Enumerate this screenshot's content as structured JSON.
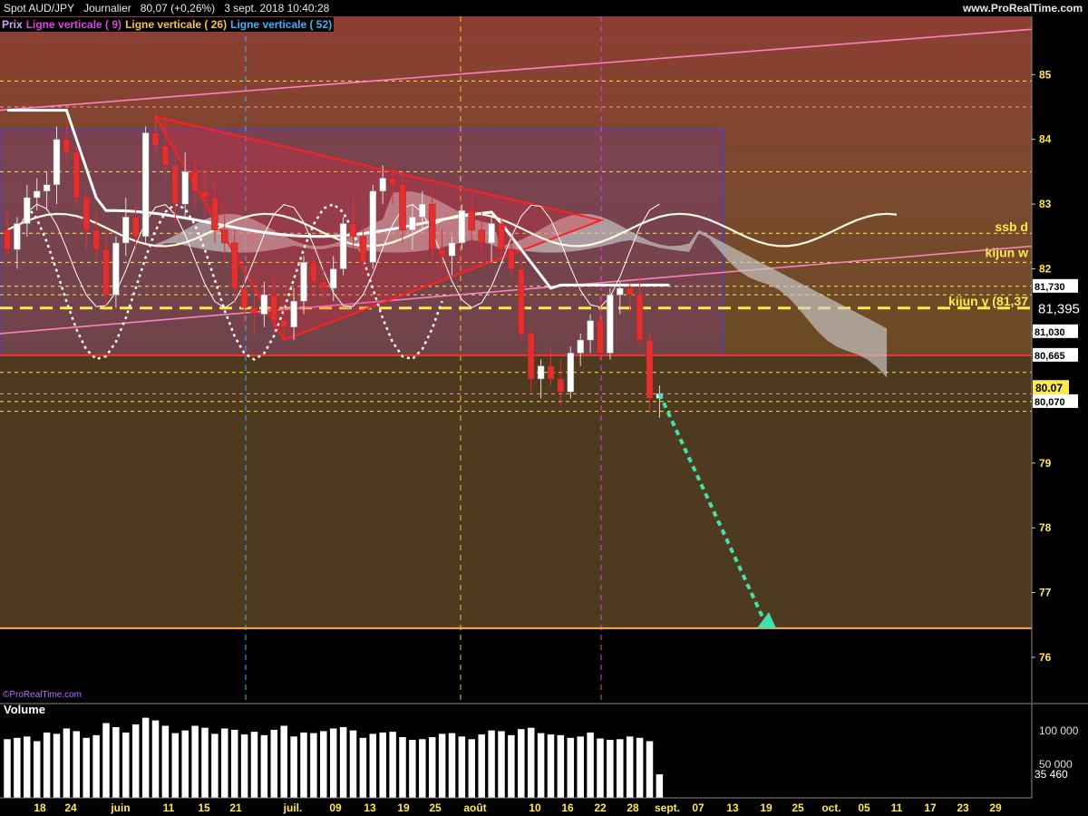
{
  "header": {
    "instrument": "Spot AUD/JPY",
    "timeframe": "Journalier",
    "last": "80,07 (+0,26%)",
    "datetime": "3 sept. 2018 10:40:28",
    "site": "www.ProRealTime.com"
  },
  "indicators": [
    {
      "label": "Prix",
      "color": "#d0a0ff"
    },
    {
      "label": "Ligne verticale ( 9)",
      "color": "#e040e0"
    },
    {
      "label": "Ligne verticale ( 26)",
      "color": "#ffc040"
    },
    {
      "label": "Ligne verticale ( 52)",
      "color": "#40b0ff"
    }
  ],
  "copyright": "©ProRealTime.com",
  "volume_panel": {
    "title": "Volume",
    "ticks": [
      {
        "value": 100000,
        "label": "100 000"
      },
      {
        "value": 50000,
        "label": "50 000"
      }
    ],
    "last_label": "35 460",
    "last_value": 35460
  },
  "price_labels": [
    {
      "label": "81,730",
      "value": 81.73,
      "style": "white"
    },
    {
      "label": "81,395",
      "value": 81.395,
      "style": "big"
    },
    {
      "label": "81,030",
      "value": 81.03,
      "style": "white"
    },
    {
      "label": "80,665",
      "value": 80.665,
      "style": "white"
    },
    {
      "label": "80.07",
      "value": 80.17,
      "style": "yellow"
    },
    {
      "label": "80,070",
      "value": 79.95,
      "style": "white"
    }
  ],
  "annotations": [
    {
      "label": "ssb d",
      "value": 82.65,
      "color": "#ffe94a"
    },
    {
      "label": "kijun w",
      "value": 82.25,
      "color": "#ffe94a"
    },
    {
      "label": "kijun y (81,37",
      "value": 81.5,
      "color": "#ffe94a"
    }
  ],
  "colors": {
    "bull": "#ffffff",
    "bear": "#e03030",
    "cloud": "#cccccc",
    "support": "#ffb040",
    "arrow": "#40e0b0",
    "triangle": "#ff2020",
    "rect": "#4040e0",
    "channel": "#ff80c0"
  },
  "chart_data": {
    "type": "candlestick",
    "ylim": [
      75.3,
      85.9
    ],
    "yticks": [
      76,
      77,
      78,
      79,
      80,
      81,
      82,
      83,
      84,
      85
    ],
    "xlabels": [
      "18",
      "24",
      "juin",
      "11",
      "15",
      "21",
      "juil.",
      "09",
      "13",
      "19",
      "25",
      "août",
      "10",
      "16",
      "22",
      "28",
      "sept.",
      "07",
      "13",
      "19",
      "25",
      "oct.",
      "05",
      "11",
      "17",
      "23",
      "29"
    ],
    "horizontal_levels": {
      "orange_support": 76.45,
      "red_level": 80.665,
      "yellow_dashed": 81.395,
      "dashed": [
        84.9,
        83.5,
        82.55,
        82.1,
        81.73,
        81.6,
        80.4,
        79.95,
        79.8
      ],
      "pink_dashed": [
        84.5,
        80.07
      ]
    },
    "ohlc": [
      [
        82.6,
        82.9,
        82.2,
        82.3
      ],
      [
        82.3,
        82.8,
        82.0,
        82.7
      ],
      [
        82.7,
        83.3,
        82.5,
        83.1
      ],
      [
        83.1,
        83.4,
        82.9,
        83.2
      ],
      [
        83.2,
        83.5,
        82.9,
        83.3
      ],
      [
        83.3,
        84.2,
        83.0,
        84.0
      ],
      [
        84.0,
        84.3,
        83.6,
        83.8
      ],
      [
        83.8,
        83.9,
        83.0,
        83.1
      ],
      [
        83.1,
        83.2,
        82.3,
        82.6
      ],
      [
        82.6,
        82.9,
        82.1,
        82.3
      ],
      [
        82.3,
        82.6,
        81.4,
        81.6
      ],
      [
        81.6,
        82.5,
        81.4,
        82.4
      ],
      [
        82.4,
        83.1,
        82.2,
        82.8
      ],
      [
        82.8,
        83.0,
        82.3,
        82.5
      ],
      [
        82.5,
        84.2,
        82.4,
        84.1
      ],
      [
        84.1,
        84.4,
        83.8,
        83.9
      ],
      [
        83.9,
        84.4,
        83.4,
        83.6
      ],
      [
        83.6,
        83.9,
        82.7,
        83.0
      ],
      [
        83.0,
        83.8,
        82.8,
        83.5
      ],
      [
        83.5,
        83.7,
        82.9,
        83.2
      ],
      [
        83.2,
        83.6,
        82.8,
        83.1
      ],
      [
        83.1,
        83.4,
        82.4,
        82.6
      ],
      [
        82.6,
        82.9,
        82.1,
        82.4
      ],
      [
        82.4,
        82.6,
        81.5,
        81.7
      ],
      [
        81.7,
        82.0,
        81.1,
        81.4
      ],
      [
        81.4,
        81.7,
        81.0,
        81.3
      ],
      [
        81.3,
        81.8,
        81.1,
        81.6
      ],
      [
        81.6,
        81.9,
        81.0,
        81.2
      ],
      [
        81.2,
        81.5,
        80.9,
        81.1
      ],
      [
        81.1,
        81.7,
        80.9,
        81.5
      ],
      [
        81.5,
        82.2,
        81.3,
        82.1
      ],
      [
        82.1,
        82.3,
        81.6,
        81.8
      ],
      [
        81.8,
        82.0,
        81.5,
        81.7
      ],
      [
        81.7,
        82.2,
        81.5,
        82.0
      ],
      [
        82.0,
        82.8,
        81.9,
        82.7
      ],
      [
        82.7,
        83.1,
        82.3,
        82.5
      ],
      [
        82.5,
        82.7,
        81.9,
        82.1
      ],
      [
        82.1,
        83.3,
        82.0,
        83.2
      ],
      [
        83.2,
        83.6,
        83.0,
        83.4
      ],
      [
        83.4,
        83.6,
        83.0,
        83.3
      ],
      [
        83.3,
        83.5,
        82.4,
        82.6
      ],
      [
        82.6,
        83.0,
        82.3,
        82.8
      ],
      [
        82.8,
        83.2,
        82.6,
        83.0
      ],
      [
        83.0,
        83.2,
        82.1,
        82.3
      ],
      [
        82.3,
        82.6,
        82.0,
        82.2
      ],
      [
        82.2,
        82.5,
        81.9,
        82.4
      ],
      [
        82.4,
        83.0,
        82.3,
        82.9
      ],
      [
        82.9,
        83.1,
        82.4,
        82.6
      ],
      [
        82.6,
        82.9,
        82.2,
        82.4
      ],
      [
        82.4,
        82.8,
        82.1,
        82.7
      ],
      [
        82.7,
        82.8,
        82.2,
        82.3
      ],
      [
        82.3,
        82.5,
        81.9,
        82.0
      ],
      [
        82.0,
        82.2,
        80.9,
        81.0
      ],
      [
        81.0,
        81.1,
        80.1,
        80.3
      ],
      [
        80.3,
        80.6,
        80.0,
        80.5
      ],
      [
        80.5,
        80.8,
        80.2,
        80.3
      ],
      [
        80.3,
        80.6,
        79.9,
        80.1
      ],
      [
        80.1,
        80.8,
        80.0,
        80.7
      ],
      [
        80.7,
        81.0,
        80.5,
        80.9
      ],
      [
        80.9,
        81.3,
        80.7,
        81.2
      ],
      [
        81.2,
        81.6,
        80.6,
        80.7
      ],
      [
        80.7,
        81.7,
        80.6,
        81.6
      ],
      [
        81.6,
        81.8,
        81.3,
        81.7
      ],
      [
        81.7,
        81.8,
        81.3,
        81.6
      ],
      [
        81.6,
        81.9,
        80.8,
        80.9
      ],
      [
        80.9,
        81.0,
        79.8,
        80.0
      ],
      [
        80.0,
        80.2,
        79.7,
        80.07
      ]
    ],
    "volume": [
      88000,
      90000,
      92000,
      85000,
      98000,
      96000,
      104000,
      100000,
      90000,
      94000,
      112000,
      106000,
      98000,
      110000,
      120000,
      116000,
      108000,
      97000,
      101000,
      108000,
      105000,
      96000,
      104000,
      102000,
      95000,
      99000,
      94000,
      102000,
      108000,
      92000,
      98000,
      97000,
      100000,
      104000,
      106000,
      101000,
      90000,
      96000,
      98000,
      99000,
      91000,
      87000,
      88000,
      91000,
      96000,
      97000,
      92000,
      88000,
      95000,
      101000,
      100000,
      94000,
      103000,
      105000,
      97000,
      95000,
      94000,
      90000,
      92000,
      98000,
      89000,
      87000,
      88000,
      92000,
      90000,
      85000,
      35460
    ]
  }
}
